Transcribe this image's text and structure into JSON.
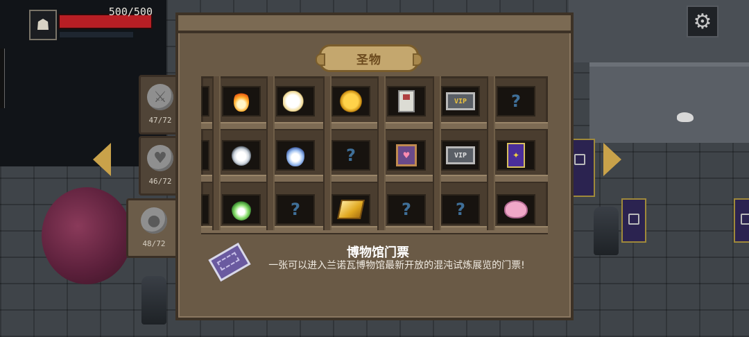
{
  "hud": {
    "hp_text": "500/500",
    "portrait_icon": "hooded-hero-icon",
    "settings_icon": "gear-icon"
  },
  "side_tabs": [
    {
      "name": "weapons",
      "icon": "sword-icon",
      "count": "47/72"
    },
    {
      "name": "armor",
      "icon": "shield-heart-icon",
      "count": "46/72"
    },
    {
      "name": "relics",
      "icon": "pouch-icon",
      "count": "48/72"
    }
  ],
  "cabinet": {
    "title": "圣物",
    "rows": [
      [
        "fire-spirit-icon",
        "white-cloud-icon",
        "golden-cloud-icon",
        "paper-card-icon",
        "gold-vip-card-icon",
        "unknown"
      ],
      [
        "white-ghost-icon",
        "blue-flame-icon",
        "unknown",
        "purple-book-icon",
        "silver-vip-card-icon",
        "purple-card-icon"
      ],
      [
        "green-spirit-icon",
        "unknown",
        "gold-book-icon",
        "unknown",
        "unknown",
        "piggy-bank-icon"
      ]
    ],
    "unknown_symbol": "?",
    "vip_label": "VIP"
  },
  "selected_item": {
    "name": "博物馆门票",
    "description": "一张可以进入兰诺瓦博物馆最新开放的混沌试炼展览的门票!",
    "icon": "museum-ticket-icon"
  },
  "colors": {
    "hp": "#b81e24",
    "arrow": "#c9a24a",
    "unknown": "#3f6f98",
    "title_plate": "#c4a76e"
  }
}
